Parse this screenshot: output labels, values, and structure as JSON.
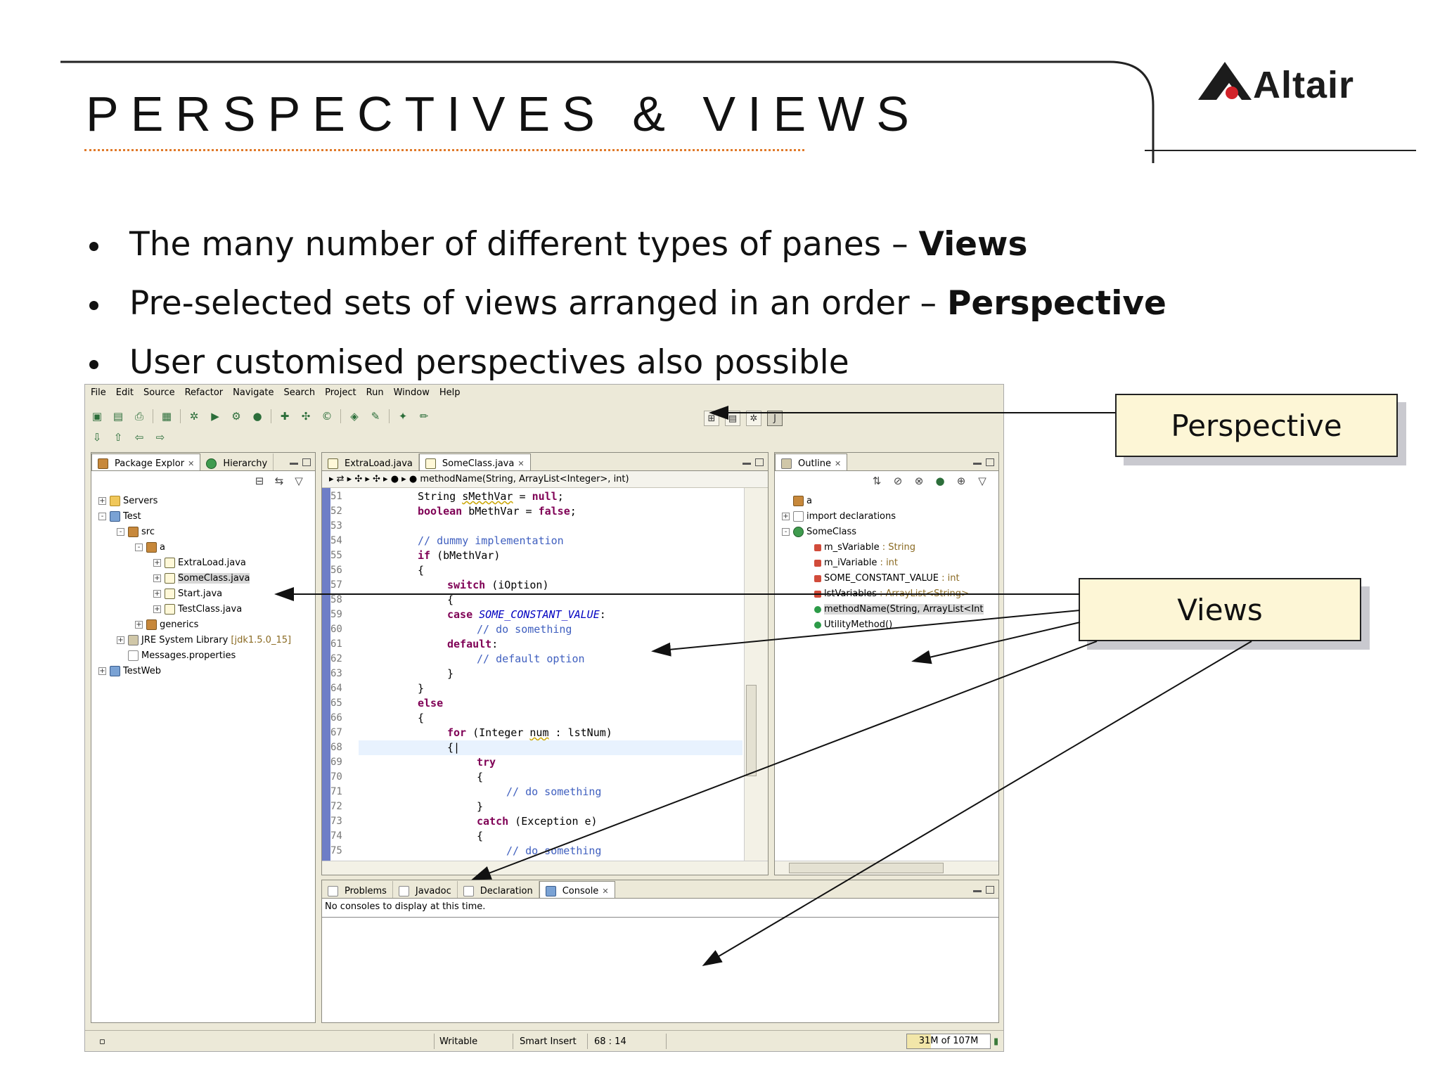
{
  "slide": {
    "title": "PERSPECTIVES & VIEWS",
    "logo_text": "Altair",
    "bullets": [
      {
        "text": "The many number of different types of panes – ",
        "bold": "Views"
      },
      {
        "text": "Pre-selected sets of views arranged in an order – ",
        "bold": "Perspective"
      },
      {
        "text": "User customised perspectives also possible",
        "bold": ""
      }
    ],
    "callouts": {
      "perspective": "Perspective",
      "views": "Views"
    }
  },
  "ide": {
    "menu": [
      "File",
      "Edit",
      "Source",
      "Refactor",
      "Navigate",
      "Search",
      "Project",
      "Run",
      "Window",
      "Help"
    ],
    "package_explorer": {
      "tabs": [
        "Package Explor",
        "Hierarchy"
      ],
      "tree": [
        {
          "label": "Servers",
          "icon": "folder-icon",
          "depth": 0,
          "exp": "+"
        },
        {
          "label": "Test",
          "icon": "project-icon",
          "depth": 0,
          "exp": "-"
        },
        {
          "label": "src",
          "icon": "source-folder-icon",
          "depth": 1,
          "exp": "-"
        },
        {
          "label": "a",
          "icon": "package-icon",
          "depth": 2,
          "exp": "-"
        },
        {
          "label": "ExtraLoad.java",
          "icon": "java-file-icon",
          "depth": 3,
          "exp": "+"
        },
        {
          "label": "SomeClass.java",
          "icon": "java-file-icon",
          "depth": 3,
          "exp": "+",
          "selected": true
        },
        {
          "label": "Start.java",
          "icon": "java-file-icon",
          "depth": 3,
          "exp": "+"
        },
        {
          "label": "TestClass.java",
          "icon": "java-file-icon",
          "depth": 3,
          "exp": "+"
        },
        {
          "label": "generics",
          "icon": "package-icon",
          "depth": 2,
          "exp": "+"
        },
        {
          "label": "JRE System Library",
          "decoration": "[jdk1.5.0_15]",
          "icon": "library-icon",
          "depth": 1,
          "exp": "+"
        },
        {
          "label": "Messages.properties",
          "icon": "properties-file-icon",
          "depth": 1,
          "exp": ""
        },
        {
          "label": "TestWeb",
          "icon": "project-icon",
          "depth": 0,
          "exp": "+"
        }
      ]
    },
    "editor": {
      "tabs": [
        "ExtraLoad.java",
        "SomeClass.java"
      ],
      "breadcrumb": "methodName(String, ArrayList<Integer>, int)",
      "lines": [
        {
          "n": "51",
          "indent": 2,
          "parts": [
            [
              "",
              "String "
            ],
            [
              "u",
              "sMethVar"
            ],
            [
              "",
              " = "
            ],
            [
              "kw",
              "null"
            ],
            [
              "",
              ";"
            ]
          ]
        },
        {
          "n": "52",
          "indent": 2,
          "parts": [
            [
              "kw",
              "boolean"
            ],
            [
              "",
              " bMethVar = "
            ],
            [
              "kw",
              "false"
            ],
            [
              "",
              ";"
            ]
          ]
        },
        {
          "n": "53",
          "indent": 0,
          "parts": []
        },
        {
          "n": "54",
          "indent": 2,
          "parts": [
            [
              "cm",
              "// dummy implementation"
            ]
          ]
        },
        {
          "n": "55",
          "indent": 2,
          "parts": [
            [
              "kw",
              "if"
            ],
            [
              "",
              " (bMethVar)"
            ]
          ]
        },
        {
          "n": "56",
          "indent": 2,
          "parts": [
            [
              "",
              "{"
            ]
          ]
        },
        {
          "n": "57",
          "indent": 3,
          "parts": [
            [
              "kw",
              "switch"
            ],
            [
              "",
              " (iOption)"
            ]
          ]
        },
        {
          "n": "58",
          "indent": 3,
          "parts": [
            [
              "",
              "{"
            ]
          ]
        },
        {
          "n": "59",
          "indent": 3,
          "parts": [
            [
              "kw",
              "case"
            ],
            [
              "",
              " "
            ],
            [
              "cst",
              "SOME_CONSTANT_VALUE"
            ],
            [
              "",
              ":"
            ]
          ]
        },
        {
          "n": "60",
          "indent": 4,
          "parts": [
            [
              "cm",
              "// do something"
            ]
          ]
        },
        {
          "n": "61",
          "indent": 3,
          "parts": [
            [
              "kw",
              "default"
            ],
            [
              "",
              ":"
            ]
          ]
        },
        {
          "n": "62",
          "indent": 4,
          "parts": [
            [
              "cm",
              "// default option"
            ]
          ]
        },
        {
          "n": "63",
          "indent": 3,
          "parts": [
            [
              "",
              "}"
            ]
          ]
        },
        {
          "n": "64",
          "indent": 2,
          "parts": [
            [
              "",
              "}"
            ]
          ]
        },
        {
          "n": "65",
          "indent": 2,
          "parts": [
            [
              "kw",
              "else"
            ]
          ]
        },
        {
          "n": "66",
          "indent": 2,
          "parts": [
            [
              "",
              "{"
            ]
          ]
        },
        {
          "n": "67",
          "indent": 3,
          "parts": [
            [
              "kw",
              "for"
            ],
            [
              "",
              " (Integer "
            ],
            [
              "u",
              "num"
            ],
            [
              "",
              " : lstNum)"
            ]
          ]
        },
        {
          "n": "68",
          "indent": 3,
          "parts": [
            [
              "",
              "{|"
            ]
          ],
          "current": true
        },
        {
          "n": "69",
          "indent": 4,
          "parts": [
            [
              "kw",
              "try"
            ]
          ]
        },
        {
          "n": "70",
          "indent": 4,
          "parts": [
            [
              "",
              "{"
            ]
          ]
        },
        {
          "n": "71",
          "indent": 5,
          "parts": [
            [
              "cm",
              "// do something"
            ]
          ]
        },
        {
          "n": "72",
          "indent": 4,
          "parts": [
            [
              "",
              "}"
            ]
          ]
        },
        {
          "n": "73",
          "indent": 4,
          "parts": [
            [
              "kw",
              "catch"
            ],
            [
              "",
              " (Exception e)"
            ]
          ]
        },
        {
          "n": "74",
          "indent": 4,
          "parts": [
            [
              "",
              "{"
            ]
          ]
        },
        {
          "n": "75",
          "indent": 5,
          "parts": [
            [
              "cm",
              "// do something"
            ]
          ]
        }
      ]
    },
    "outline": {
      "tab": "Outline",
      "items": [
        {
          "label": "a",
          "type": "",
          "icon": "package-icon",
          "depth": 0,
          "exp": ""
        },
        {
          "label": "import declarations",
          "type": "",
          "icon": "imports-icon",
          "depth": 0,
          "exp": "+"
        },
        {
          "label": "SomeClass",
          "type": "",
          "icon": "class-icon",
          "depth": 0,
          "exp": "-"
        },
        {
          "label": "m_sVariable",
          "type": " : String",
          "icon": "private-field-icon",
          "depth": 1,
          "exp": ""
        },
        {
          "label": "m_iVariable",
          "type": " : int",
          "icon": "private-field-icon",
          "depth": 1,
          "exp": ""
        },
        {
          "label": "SOME_CONSTANT_VALUE",
          "type": " : int",
          "icon": "static-final-field-icon",
          "depth": 1,
          "exp": ""
        },
        {
          "label": "lstVariables",
          "type": " : ArrayList<String>",
          "icon": "private-field-icon",
          "depth": 1,
          "exp": ""
        },
        {
          "label": "methodName(String, ArrayList<Int",
          "type": "",
          "icon": "method-icon",
          "depth": 1,
          "exp": "",
          "selected": true
        },
        {
          "label": "UtilityMethod()",
          "type": "",
          "icon": "static-method-icon",
          "depth": 1,
          "exp": ""
        }
      ]
    },
    "bottom": {
      "tabs": [
        "Problems",
        "Javadoc",
        "Declaration",
        "Console"
      ],
      "active_tab": "Console",
      "message": "No consoles to display at this time."
    },
    "status": {
      "mode": "Writable",
      "insert": "Smart Insert",
      "position": "68 : 14",
      "heap": "31M of 107M",
      "heap_used_fraction": 0.29
    }
  }
}
